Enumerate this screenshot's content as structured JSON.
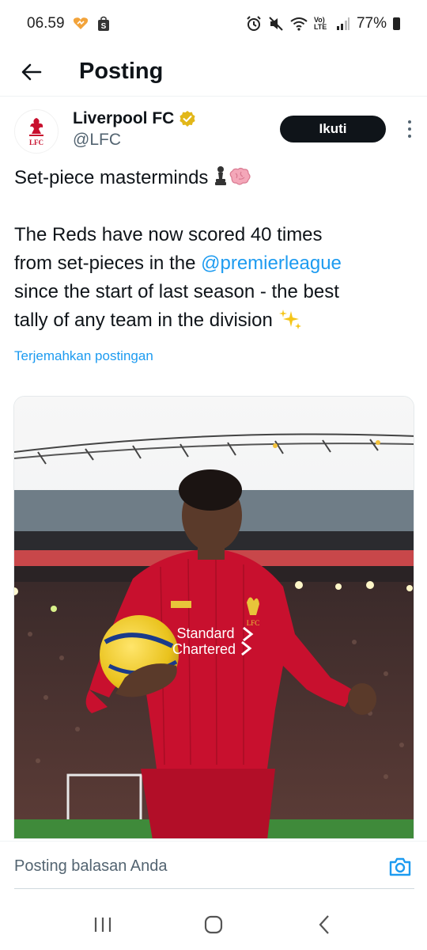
{
  "status_bar": {
    "time": "06.59",
    "battery": "77%",
    "network": "Vo) LTE"
  },
  "header": {
    "title": "Posting"
  },
  "tweet": {
    "author_name": "Liverpool FC",
    "author_handle": "@LFC",
    "avatar_text": "LFC",
    "follow_label": "Ikuti",
    "text_line1": "Set-piece masterminds ",
    "text_line2": "The Reds have now scored 40 times",
    "text_line3_pre": "from set-pieces in the ",
    "text_line3_mention": "@premierleague",
    "text_line4": "since the start of last season - the best",
    "text_line5": "tally of any team in the division ",
    "translate_label": "Terjemahkan postingan",
    "media_sponsor_line1": "Standard",
    "media_sponsor_line2": "Chartered",
    "media_crest_text": "LFC"
  },
  "reply": {
    "placeholder": "Posting balasan Anda"
  },
  "colors": {
    "accent": "#1d9bf0",
    "text": "#0f1419",
    "secondary": "#536471",
    "verified": "#e2b719",
    "kit_red": "#c8102e"
  },
  "icons": [
    "back-arrow-icon",
    "verified-badge-icon",
    "more-vertical-icon",
    "chess-pawn-icon",
    "brain-icon",
    "sparkles-icon",
    "camera-icon",
    "recent-apps-icon",
    "home-icon",
    "back-nav-icon",
    "alarm-icon",
    "mute-icon",
    "wifi-icon",
    "signal-icon",
    "battery-icon"
  ]
}
